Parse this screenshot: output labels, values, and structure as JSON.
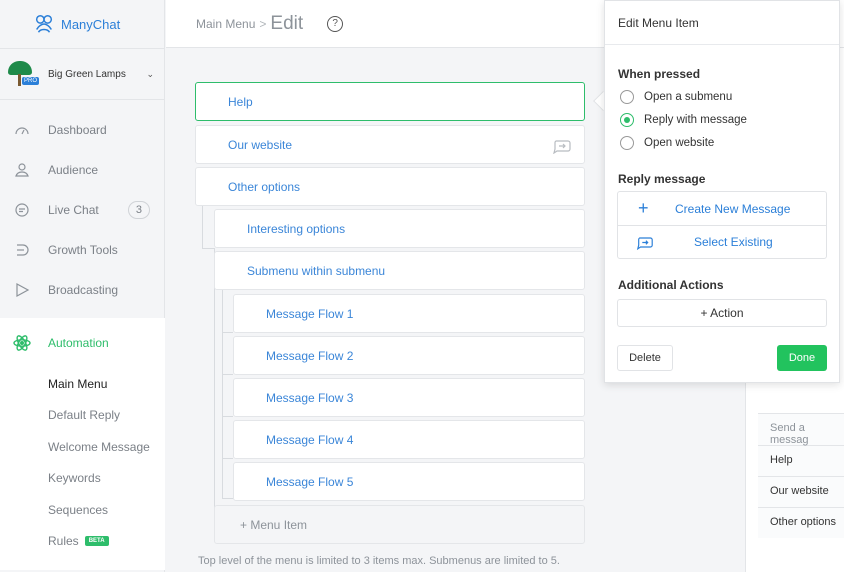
{
  "brand": {
    "name": "ManyChat"
  },
  "account": {
    "name": "Big Green Lamps",
    "badge": "PRO"
  },
  "nav": [
    {
      "label": "Dashboard",
      "icon": "dashboard-icon"
    },
    {
      "label": "Audience",
      "icon": "audience-icon"
    },
    {
      "label": "Live Chat",
      "icon": "chat-icon",
      "count": "3"
    },
    {
      "label": "Growth Tools",
      "icon": "growth-tools-icon"
    },
    {
      "label": "Broadcasting",
      "icon": "broadcasting-icon"
    }
  ],
  "automation": {
    "label": "Automation",
    "items": [
      {
        "label": "Main Menu",
        "active": true
      },
      {
        "label": "Default Reply"
      },
      {
        "label": "Welcome Message"
      },
      {
        "label": "Keywords"
      },
      {
        "label": "Sequences"
      },
      {
        "label": "Rules",
        "badge": "BETA"
      }
    ]
  },
  "header": {
    "breadcrumb": "Main Menu",
    "separator": ">",
    "page": "Edit",
    "help": "?"
  },
  "menu": {
    "level1": [
      "Help",
      "Our website",
      "Other options"
    ],
    "level2": [
      "Interesting options",
      "Submenu within submenu"
    ],
    "level3": [
      "Message Flow 1",
      "Message Flow 2",
      "Message Flow 3",
      "Message Flow 4",
      "Message Flow 5"
    ],
    "add_item": "+ Menu Item",
    "limit_note": "Top level of the menu is limited to 3 items max. Submenus are limited to 5."
  },
  "preview": {
    "send_placeholder": "Send a messag",
    "options": [
      "Help",
      "Our website",
      "Other options"
    ]
  },
  "panel": {
    "title": "Edit Menu Item",
    "when_pressed": "When pressed",
    "options": [
      {
        "label": "Open a submenu",
        "selected": false
      },
      {
        "label": "Reply with message",
        "selected": true
      },
      {
        "label": "Open website",
        "selected": false
      }
    ],
    "reply_title": "Reply message",
    "create_new": "Create New Message",
    "select_existing": "Select Existing",
    "additional_title": "Additional Actions",
    "action_button": "+ Action",
    "delete": "Delete",
    "done": "Done"
  },
  "colors": {
    "accent_green": "#2ebd6b",
    "link_blue": "#2b7fd8",
    "done_green": "#22c35e"
  }
}
